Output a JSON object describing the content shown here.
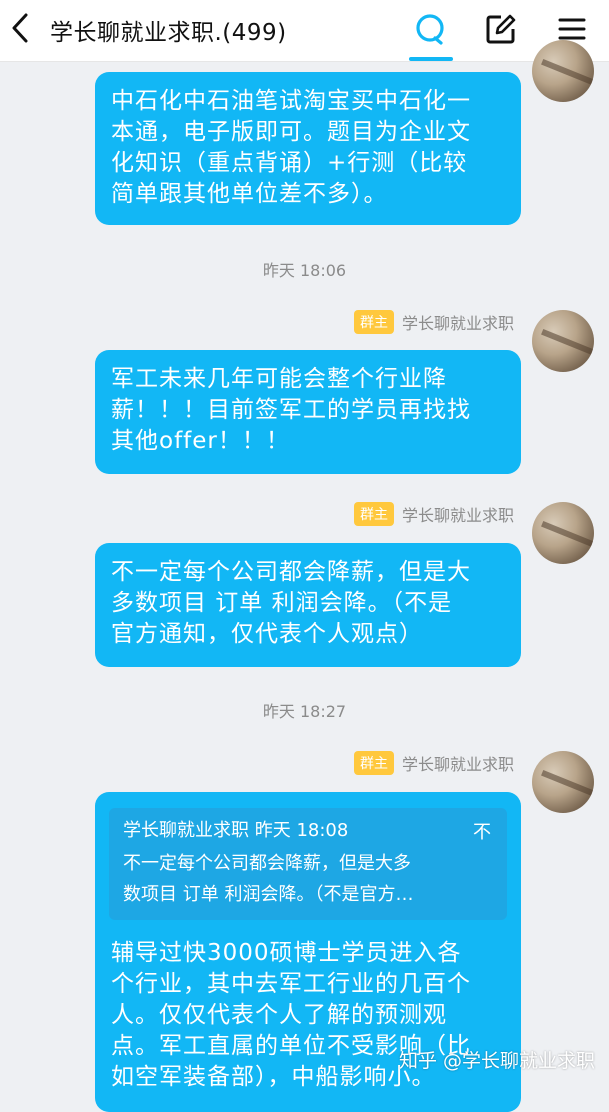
{
  "header": {
    "title": "学长聊就业求职.(499)"
  },
  "messages": [
    {
      "text_lines": [
        "中石化中石油笔试淘宝买中石化一",
        "本通，电子版即可。题目为企业文",
        "化知识（重点背诵）+行测（比较",
        "简单跟其他单位差不多）。"
      ]
    },
    {
      "time": "昨天 18:06"
    },
    {
      "role_badge": "群主",
      "sender": "学长聊就业求职",
      "text_lines": [
        "军工未来几年可能会整个行业降",
        "薪！！！目前签军工的学员再找找",
        "其他offer！！！"
      ]
    },
    {
      "role_badge": "群主",
      "sender": "学长聊就业求职",
      "text_lines": [
        "不一定每个公司都会降薪，但是大",
        "多数项目 订单 利润会降。（不是",
        "官方通知，仅代表个人观点）"
      ]
    },
    {
      "time": "昨天 18:27"
    },
    {
      "role_badge": "群主",
      "sender": "学长聊就业求职",
      "quote": {
        "header": "学长聊就业求职 昨天 18:08",
        "close": "不",
        "lines": [
          "不一定每个公司都会降薪，但是大多",
          "数项目 订单 利润会降。（不是官方…"
        ]
      },
      "text_lines": [
        "辅导过快3000硕博士学员进入各",
        "个行业，其中去军工行业的几百个",
        "人。仅仅代表个人了解的预测观",
        "点。军工直属的单位不受影响（比",
        "如空军装备部），中船影响小。"
      ]
    }
  ],
  "watermark": "知乎 @学长聊就业求职",
  "colors": {
    "bubble": "#12b7f5",
    "quote": "#1ea7e4",
    "badge": "#ffc83d",
    "background": "#eef0f3"
  },
  "icons": [
    "back-arrow-icon",
    "chat-bubble-icon",
    "edit-icon",
    "menu-icon"
  ]
}
